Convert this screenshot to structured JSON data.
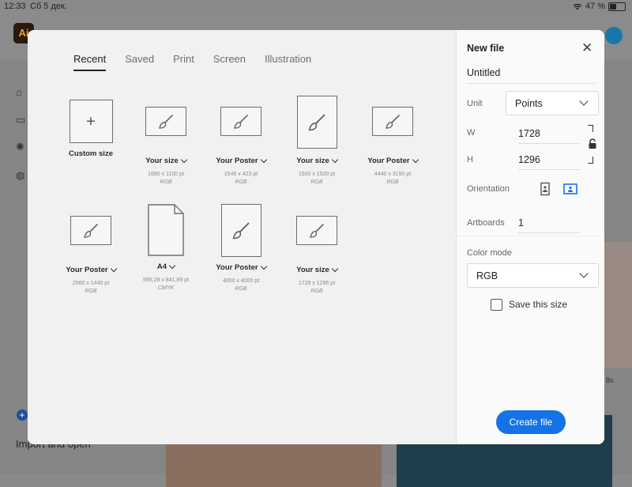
{
  "status": {
    "time": "12:33",
    "date": "Сб 5 дек.",
    "battery": "47 %"
  },
  "background": {
    "logo_text": "Ai",
    "import_label": "Import and open",
    "duration_fragment": "8s"
  },
  "tabs": [
    {
      "label": "Recent",
      "active": true
    },
    {
      "label": "Saved",
      "active": false
    },
    {
      "label": "Print",
      "active": false
    },
    {
      "label": "Screen",
      "active": false
    },
    {
      "label": "Illustration",
      "active": false
    }
  ],
  "presets": [
    {
      "name": "Custom size",
      "dims": "",
      "mode": "",
      "icon": "plus-icon",
      "has_chevron": false
    },
    {
      "name": "Your size",
      "dims": "1680 x 1100 pt",
      "mode": "RGB",
      "icon": "paintbrush-icon",
      "has_chevron": true
    },
    {
      "name": "Your Poster",
      "dims": "1546 x 423 pt",
      "mode": "RGB",
      "icon": "paintbrush-icon",
      "has_chevron": true
    },
    {
      "name": "Your size",
      "dims": "1500 x 1500 pt",
      "mode": "RGB",
      "icon": "paintbrush-icon",
      "has_chevron": true
    },
    {
      "name": "Your Poster",
      "dims": "4440 x 3150 pt",
      "mode": "RGB",
      "icon": "paintbrush-icon",
      "has_chevron": true
    },
    {
      "name": "Your Poster",
      "dims": "2560 x 1440 pt",
      "mode": "RGB",
      "icon": "paintbrush-icon",
      "has_chevron": true
    },
    {
      "name": "A4",
      "dims": "595,28 x 841,89 pt",
      "mode": "CMYK",
      "icon": "document-icon",
      "has_chevron": true
    },
    {
      "name": "Your Poster",
      "dims": "4000 x 4000 pt",
      "mode": "RGB",
      "icon": "paintbrush-icon",
      "has_chevron": true
    },
    {
      "name": "Your size",
      "dims": "1728 x 1296 pt",
      "mode": "RGB",
      "icon": "paintbrush-icon",
      "has_chevron": true
    }
  ],
  "new_file": {
    "title": "New file",
    "name_value": "Untitled",
    "unit_label": "Unit",
    "unit_value": "Points",
    "w_label": "W",
    "w_value": "1728",
    "h_label": "H",
    "h_value": "1296",
    "orientation_label": "Orientation",
    "orientation_selected": "landscape",
    "artboards_label": "Artboards",
    "artboards_value": "1",
    "color_mode_label": "Color mode",
    "color_mode_value": "RGB",
    "save_size_label": "Save this size",
    "save_size_checked": false,
    "create_label": "Create file",
    "accent_color": "#1473e6"
  }
}
